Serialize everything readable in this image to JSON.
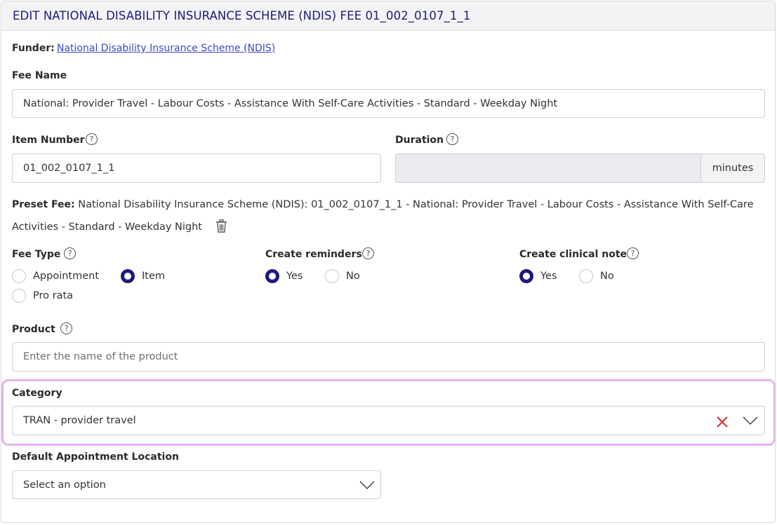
{
  "header": {
    "title": "EDIT NATIONAL DISABILITY INSURANCE SCHEME (NDIS) FEE 01_002_0107_1_1"
  },
  "funder": {
    "label": "Funder:",
    "link": "National Disability Insurance Scheme (NDIS)"
  },
  "fee_name": {
    "label": "Fee Name",
    "value": "National: Provider Travel - Labour Costs - Assistance With Self-Care Activities - Standard - Weekday Night"
  },
  "item_number": {
    "label": "Item Number",
    "value": "01_002_0107_1_1"
  },
  "duration": {
    "label": "Duration",
    "value": "",
    "unit": "minutes"
  },
  "preset_fee": {
    "label": "Preset Fee:",
    "line1": "National Disability Insurance Scheme (NDIS): 01_002_0107_1_1 - National: Provider Travel - Labour Costs - Assistance With Self-Care",
    "line2": "Activities - Standard - Weekday Night",
    "delete_icon": "trash-icon"
  },
  "fee_type": {
    "label": "Fee Type",
    "options": [
      "Appointment",
      "Item",
      "Pro rata"
    ],
    "selected": "Item"
  },
  "create_reminders": {
    "label": "Create reminders",
    "options": [
      "Yes",
      "No"
    ],
    "selected": "Yes"
  },
  "create_clinical_note": {
    "label": "Create clinical note",
    "options": [
      "Yes",
      "No"
    ],
    "selected": "Yes"
  },
  "product": {
    "label": "Product",
    "placeholder": "Enter the name of the product",
    "value": ""
  },
  "category": {
    "label": "Category",
    "value": "TRAN - provider travel"
  },
  "default_location": {
    "label": "Default Appointment Location",
    "placeholder": "Select an option"
  },
  "colors": {
    "accent": "#1d1a78",
    "link": "#3a48c8",
    "clear": "#d6303a",
    "highlight": "#e6b3f0"
  }
}
